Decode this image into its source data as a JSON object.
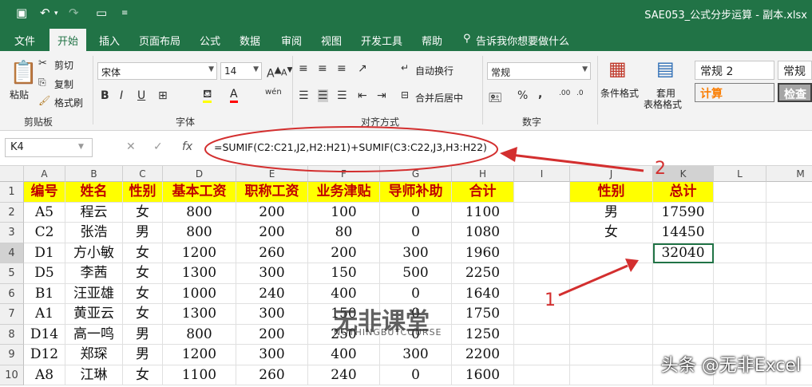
{
  "window": {
    "title": "SAE053_公式分步运算 - 副本.xlsx",
    "accent_color": "#217346"
  },
  "ribbon_tabs": [
    "文件",
    "开始",
    "插入",
    "页面布局",
    "公式",
    "数据",
    "审阅",
    "视图",
    "开发工具",
    "帮助",
    "告诉我你想要做什么"
  ],
  "ribbon": {
    "clipboard": {
      "paste": "粘贴",
      "cut": "剪切",
      "copy": "复制",
      "format_painter": "格式刷",
      "group": "剪贴板"
    },
    "font": {
      "name": "宋体",
      "size": "14",
      "group": "字体",
      "bold": "B",
      "italic": "I",
      "underline": "U",
      "phonetic": "wén"
    },
    "alignment": {
      "wrap": "自动换行",
      "merge": "合并后居中",
      "group": "对齐方式"
    },
    "number": {
      "format": "常规",
      "group": "数字",
      "percent": "%",
      "comma": ","
    },
    "styles": {
      "conditional": "条件格式",
      "table_line1": "套用",
      "table_line2": "表格格式",
      "style1": "常规 2",
      "style2": "常规",
      "calc": "计算",
      "check": "检查"
    }
  },
  "formula_bar": {
    "name_box": "K4",
    "fx": "fx",
    "formula": "=SUMIF(C2:C21,J2,H2:H21)+SUMIF(C3:C22,J3,H3:H22)"
  },
  "columns": [
    "A",
    "B",
    "C",
    "D",
    "E",
    "F",
    "G",
    "H",
    "I",
    "J",
    "K",
    "L",
    "M"
  ],
  "rows": [
    "1",
    "2",
    "3",
    "4",
    "5",
    "6",
    "7",
    "8",
    "9",
    "10"
  ],
  "table": {
    "headers": [
      "编号",
      "姓名",
      "性别",
      "基本工资",
      "职称工资",
      "业务津贴",
      "导师补助",
      "合计"
    ],
    "data": [
      [
        "A5",
        "程云",
        "女",
        "800",
        "200",
        "100",
        "0",
        "1100"
      ],
      [
        "C2",
        "张浩",
        "男",
        "800",
        "200",
        "80",
        "0",
        "1080"
      ],
      [
        "D1",
        "方小敏",
        "女",
        "1200",
        "260",
        "200",
        "300",
        "1960"
      ],
      [
        "D5",
        "李茜",
        "女",
        "1300",
        "300",
        "150",
        "500",
        "2250"
      ],
      [
        "B1",
        "汪亚雄",
        "女",
        "1000",
        "240",
        "400",
        "0",
        "1640"
      ],
      [
        "A1",
        "黄亚云",
        "女",
        "1300",
        "300",
        "150",
        "0",
        "1750"
      ],
      [
        "D14",
        "高一鸣",
        "男",
        "800",
        "200",
        "250",
        "0",
        "1250"
      ],
      [
        "D12",
        "郑琛",
        "男",
        "1200",
        "300",
        "400",
        "300",
        "2200"
      ],
      [
        "A8",
        "江琳",
        "女",
        "1100",
        "260",
        "240",
        "0",
        "1600"
      ]
    ]
  },
  "summary": {
    "headers": [
      "性别",
      "总计"
    ],
    "rows": [
      [
        "男",
        "17590"
      ],
      [
        "女",
        "14450"
      ],
      [
        "",
        "32040"
      ]
    ]
  },
  "annotations": {
    "label1": "1",
    "label2": "2",
    "color": "#d32f2f"
  },
  "watermark": "头条 @无非Excel",
  "logo": {
    "main": "无非课堂",
    "sub": "NOTHINGBUTCOURSE"
  }
}
